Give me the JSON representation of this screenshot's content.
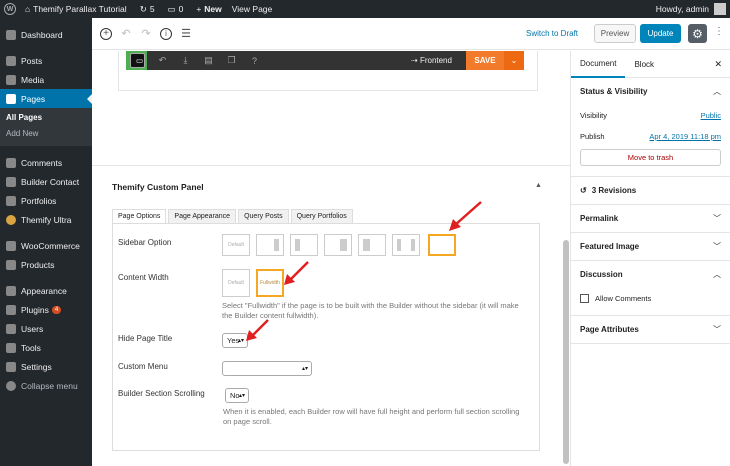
{
  "admin_bar": {
    "site": "Themify Parallax Tutorial",
    "updates": "5",
    "comments": "0",
    "new": "New",
    "view": "View Page",
    "howdy": "Howdy, admin"
  },
  "sidebar": {
    "items": [
      {
        "label": "Dashboard",
        "icon": "dashboard-icon"
      },
      {
        "label": "Posts",
        "icon": "pin-icon"
      },
      {
        "label": "Media",
        "icon": "media-icon"
      },
      {
        "label": "Pages",
        "icon": "pages-icon"
      },
      {
        "label": "Comments",
        "icon": "comments-icon"
      },
      {
        "label": "Builder Contact",
        "icon": "pin-icon"
      },
      {
        "label": "Portfolios",
        "icon": "folder-icon"
      },
      {
        "label": "Themify Ultra",
        "icon": "themify-icon"
      },
      {
        "label": "WooCommerce",
        "icon": "woo-icon"
      },
      {
        "label": "Products",
        "icon": "box-icon"
      },
      {
        "label": "Appearance",
        "icon": "brush-icon"
      },
      {
        "label": "Plugins",
        "icon": "plug-icon",
        "badge": "4"
      },
      {
        "label": "Users",
        "icon": "user-icon"
      },
      {
        "label": "Tools",
        "icon": "wrench-icon"
      },
      {
        "label": "Settings",
        "icon": "settings-icon"
      },
      {
        "label": "Collapse menu",
        "icon": "collapse-icon"
      }
    ],
    "submenu": [
      "All Pages",
      "Add New"
    ]
  },
  "toolbar": {
    "switch_draft": "Switch to Draft",
    "preview": "Preview",
    "update": "Update"
  },
  "builder": {
    "frontend": "Frontend",
    "save": "SAVE"
  },
  "panel": {
    "title": "Themify Custom Panel",
    "tabs": [
      "Page Options",
      "Page Appearance",
      "Query Posts",
      "Query Portfolios"
    ],
    "sidebar_option": "Sidebar Option",
    "default": "Default",
    "content_width": "Content Width",
    "fullwidth": "Fullwidth",
    "fullwidth_help": "Select \"Fullwidth\" if the page is to be built with the Builder without the sidebar (it will make the Builder content fullwidth).",
    "hide_title": "Hide Page Title",
    "hide_title_value": "Yes",
    "custom_menu": "Custom Menu",
    "custom_menu_value": "",
    "scrolling": "Builder Section Scrolling",
    "scrolling_value": "No",
    "scrolling_help": "When it is enabled, each Builder row will have full height and perform full section scrolling on page scroll."
  },
  "settings": {
    "tab_document": "Document",
    "tab_block": "Block",
    "status_title": "Status & Visibility",
    "visibility_label": "Visibility",
    "visibility_value": "Public",
    "publish_label": "Publish",
    "publish_value": "Apr 4, 2019 11:18 pm",
    "trash": "Move to trash",
    "revisions": "3 Revisions",
    "permalink": "Permalink",
    "featured": "Featured Image",
    "discussion": "Discussion",
    "allow_comments": "Allow Comments",
    "attributes": "Page Attributes"
  },
  "colors": {
    "accent": "#0073aa",
    "builder_green": "#4caf50",
    "save_orange": "#f27b2b",
    "highlight": "#f5a623",
    "arrow": "#e02020"
  }
}
